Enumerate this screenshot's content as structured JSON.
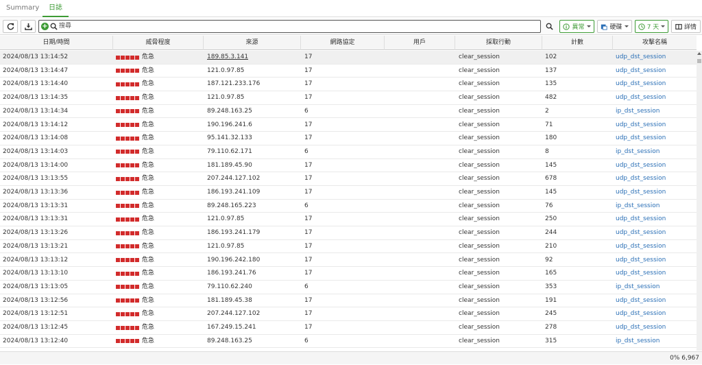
{
  "tabs": [
    {
      "label": "Summary",
      "active": false
    },
    {
      "label": "日誌",
      "active": true
    }
  ],
  "toolbar": {
    "search_placeholder": "搜尋",
    "filter_label": "異常",
    "device_label": "硬碟",
    "time_label": "7 天",
    "details_label": "詳情"
  },
  "columns": [
    "日期/時間",
    "威脅程度",
    "來源",
    "網路協定",
    "用戶",
    "採取行動",
    "計數",
    "攻擊名稱"
  ],
  "severity_label": "危急",
  "severity_color": "#d22b2b",
  "accent_color": "#3d9b35",
  "link_color": "#2a6fb6",
  "rows": [
    {
      "datetime": "2024/08/13 13:14:52",
      "source": "189.85.3.141",
      "protocol": "17",
      "user": "",
      "action": "clear_session",
      "count": "102",
      "attack": "udp_dst_session"
    },
    {
      "datetime": "2024/08/13 13:14:47",
      "source": "121.0.97.85",
      "protocol": "17",
      "user": "",
      "action": "clear_session",
      "count": "137",
      "attack": "udp_dst_session"
    },
    {
      "datetime": "2024/08/13 13:14:40",
      "source": "187.121.233.176",
      "protocol": "17",
      "user": "",
      "action": "clear_session",
      "count": "135",
      "attack": "udp_dst_session"
    },
    {
      "datetime": "2024/08/13 13:14:35",
      "source": "121.0.97.85",
      "protocol": "17",
      "user": "",
      "action": "clear_session",
      "count": "482",
      "attack": "udp_dst_session"
    },
    {
      "datetime": "2024/08/13 13:14:34",
      "source": "89.248.163.25",
      "protocol": "6",
      "user": "",
      "action": "clear_session",
      "count": "2",
      "attack": "ip_dst_session"
    },
    {
      "datetime": "2024/08/13 13:14:12",
      "source": "190.196.241.6",
      "protocol": "17",
      "user": "",
      "action": "clear_session",
      "count": "71",
      "attack": "udp_dst_session"
    },
    {
      "datetime": "2024/08/13 13:14:08",
      "source": "95.141.32.133",
      "protocol": "17",
      "user": "",
      "action": "clear_session",
      "count": "180",
      "attack": "udp_dst_session"
    },
    {
      "datetime": "2024/08/13 13:14:03",
      "source": "79.110.62.171",
      "protocol": "6",
      "user": "",
      "action": "clear_session",
      "count": "8",
      "attack": "ip_dst_session"
    },
    {
      "datetime": "2024/08/13 13:14:00",
      "source": "181.189.45.90",
      "protocol": "17",
      "user": "",
      "action": "clear_session",
      "count": "145",
      "attack": "udp_dst_session"
    },
    {
      "datetime": "2024/08/13 13:13:55",
      "source": "207.244.127.102",
      "protocol": "17",
      "user": "",
      "action": "clear_session",
      "count": "678",
      "attack": "udp_dst_session"
    },
    {
      "datetime": "2024/08/13 13:13:36",
      "source": "186.193.241.109",
      "protocol": "17",
      "user": "",
      "action": "clear_session",
      "count": "145",
      "attack": "udp_dst_session"
    },
    {
      "datetime": "2024/08/13 13:13:31",
      "source": "89.248.165.223",
      "protocol": "6",
      "user": "",
      "action": "clear_session",
      "count": "76",
      "attack": "ip_dst_session"
    },
    {
      "datetime": "2024/08/13 13:13:31",
      "source": "121.0.97.85",
      "protocol": "17",
      "user": "",
      "action": "clear_session",
      "count": "250",
      "attack": "udp_dst_session"
    },
    {
      "datetime": "2024/08/13 13:13:26",
      "source": "186.193.241.179",
      "protocol": "17",
      "user": "",
      "action": "clear_session",
      "count": "244",
      "attack": "udp_dst_session"
    },
    {
      "datetime": "2024/08/13 13:13:21",
      "source": "121.0.97.85",
      "protocol": "17",
      "user": "",
      "action": "clear_session",
      "count": "210",
      "attack": "udp_dst_session"
    },
    {
      "datetime": "2024/08/13 13:13:12",
      "source": "190.196.242.180",
      "protocol": "17",
      "user": "",
      "action": "clear_session",
      "count": "92",
      "attack": "udp_dst_session"
    },
    {
      "datetime": "2024/08/13 13:13:10",
      "source": "186.193.241.76",
      "protocol": "17",
      "user": "",
      "action": "clear_session",
      "count": "165",
      "attack": "udp_dst_session"
    },
    {
      "datetime": "2024/08/13 13:13:05",
      "source": "79.110.62.240",
      "protocol": "6",
      "user": "",
      "action": "clear_session",
      "count": "353",
      "attack": "ip_dst_session"
    },
    {
      "datetime": "2024/08/13 13:12:56",
      "source": "181.189.45.38",
      "protocol": "17",
      "user": "",
      "action": "clear_session",
      "count": "191",
      "attack": "udp_dst_session"
    },
    {
      "datetime": "2024/08/13 13:12:51",
      "source": "207.244.127.102",
      "protocol": "17",
      "user": "",
      "action": "clear_session",
      "count": "245",
      "attack": "udp_dst_session"
    },
    {
      "datetime": "2024/08/13 13:12:45",
      "source": "167.249.15.241",
      "protocol": "17",
      "user": "",
      "action": "clear_session",
      "count": "278",
      "attack": "udp_dst_session"
    },
    {
      "datetime": "2024/08/13 13:12:40",
      "source": "89.248.163.25",
      "protocol": "6",
      "user": "",
      "action": "clear_session",
      "count": "315",
      "attack": "ip_dst_session"
    }
  ],
  "footer": {
    "count_text": "0% 6,967"
  }
}
